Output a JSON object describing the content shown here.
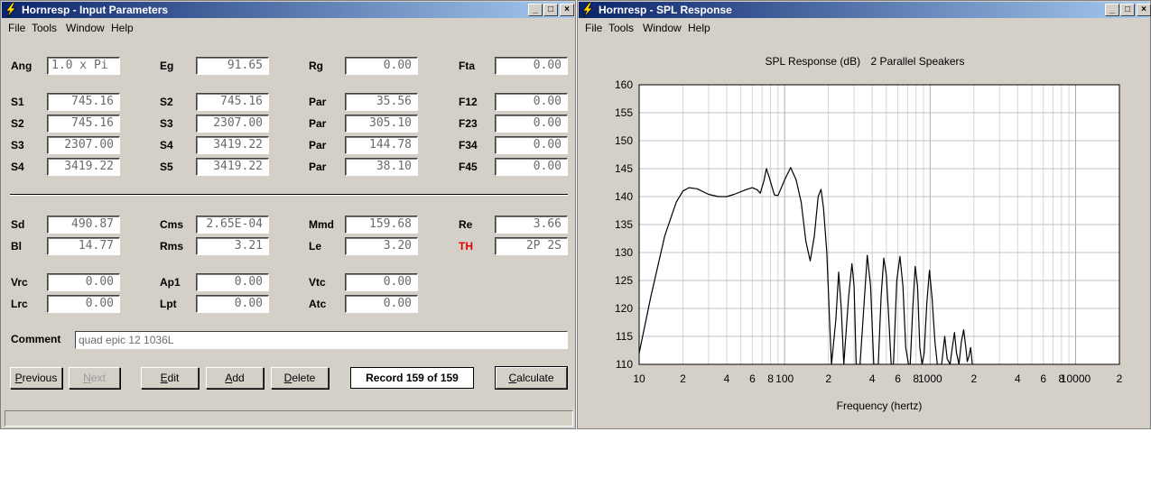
{
  "input_window": {
    "title": "Hornresp - Input Parameters",
    "menu": [
      "File",
      "Tools",
      "Window",
      "Help"
    ],
    "rows": [
      [
        {
          "label": "Ang",
          "value": "1.0 x Pi"
        },
        {
          "label": "Eg",
          "value": "91.65"
        },
        {
          "label": "Rg",
          "value": "0.00"
        },
        {
          "label": "Fta",
          "value": "0.00"
        }
      ],
      [
        {
          "label": "S1",
          "value": "745.16"
        },
        {
          "label": "S2",
          "value": "745.16"
        },
        {
          "label": "Par",
          "value": "35.56"
        },
        {
          "label": "F12",
          "value": "0.00"
        }
      ],
      [
        {
          "label": "S2",
          "value": "745.16"
        },
        {
          "label": "S3",
          "value": "2307.00"
        },
        {
          "label": "Par",
          "value": "305.10"
        },
        {
          "label": "F23",
          "value": "0.00"
        }
      ],
      [
        {
          "label": "S3",
          "value": "2307.00"
        },
        {
          "label": "S4",
          "value": "3419.22"
        },
        {
          "label": "Par",
          "value": "144.78"
        },
        {
          "label": "F34",
          "value": "0.00"
        }
      ],
      [
        {
          "label": "S4",
          "value": "3419.22"
        },
        {
          "label": "S5",
          "value": "3419.22"
        },
        {
          "label": "Par",
          "value": "38.10"
        },
        {
          "label": "F45",
          "value": "0.00"
        }
      ],
      [
        {
          "label": "Sd",
          "value": "490.87"
        },
        {
          "label": "Cms",
          "value": "2.65E-04"
        },
        {
          "label": "Mmd",
          "value": "159.68"
        },
        {
          "label": "Re",
          "value": "3.66"
        }
      ],
      [
        {
          "label": "Bl",
          "value": "14.77"
        },
        {
          "label": "Rms",
          "value": "3.21"
        },
        {
          "label": "Le",
          "value": "3.20"
        },
        {
          "label": "TH",
          "value": "2P 2S"
        }
      ],
      [
        {
          "label": "Vrc",
          "value": "0.00"
        },
        {
          "label": "Ap1",
          "value": "0.00"
        },
        {
          "label": "Vtc",
          "value": "0.00"
        }
      ],
      [
        {
          "label": "Lrc",
          "value": "0.00"
        },
        {
          "label": "Lpt",
          "value": "0.00"
        },
        {
          "label": "Atc",
          "value": "0.00"
        }
      ]
    ],
    "comment_label": "Comment",
    "comment_value": "quad epic 12 1036L",
    "buttons": {
      "previous": "Previous",
      "next": "Next",
      "edit": "Edit",
      "add": "Add",
      "delete": "Delete",
      "calculate": "Calculate"
    },
    "record": "Record 159 of 159"
  },
  "spl_window": {
    "title": "Hornresp - SPL Response",
    "menu": [
      "File",
      "Tools",
      "Window",
      "Help"
    ]
  },
  "colors": {
    "title_start": "#0a246a",
    "title_end": "#a6caf0",
    "window_bg": "#d4d0c8",
    "th_label": "#e00000"
  },
  "chart_data": {
    "type": "line",
    "title": "SPL Response (dB)",
    "subtitle": "2 Parallel Speakers",
    "xlabel": "Frequency (hertz)",
    "ylabel": "",
    "xscale": "log",
    "xlim": [
      10,
      20000
    ],
    "ylim": [
      110,
      160
    ],
    "yticks": [
      110,
      115,
      120,
      125,
      130,
      135,
      140,
      145,
      150,
      155,
      160
    ],
    "xtick_labels": [
      {
        "x": 10,
        "label": "10"
      },
      {
        "x": 20,
        "label": "2"
      },
      {
        "x": 40,
        "label": "4"
      },
      {
        "x": 60,
        "label": "6"
      },
      {
        "x": 80,
        "label": "8"
      },
      {
        "x": 100,
        "label": "100"
      },
      {
        "x": 200,
        "label": "2"
      },
      {
        "x": 400,
        "label": "4"
      },
      {
        "x": 600,
        "label": "6"
      },
      {
        "x": 800,
        "label": "8"
      },
      {
        "x": 1000,
        "label": "1000"
      },
      {
        "x": 2000,
        "label": "2"
      },
      {
        "x": 4000,
        "label": "4"
      },
      {
        "x": 6000,
        "label": "6"
      },
      {
        "x": 8000,
        "label": "8"
      },
      {
        "x": 10000,
        "label": "10000"
      },
      {
        "x": 20000,
        "label": "2"
      }
    ],
    "grid": true,
    "series": [
      {
        "points": [
          [
            10,
            112
          ],
          [
            12,
            122
          ],
          [
            15,
            133
          ],
          [
            18,
            139
          ],
          [
            20,
            141
          ],
          [
            22,
            141.6
          ],
          [
            25,
            141.4
          ],
          [
            30,
            140.4
          ],
          [
            35,
            140
          ],
          [
            40,
            140
          ],
          [
            45,
            140.4
          ],
          [
            55,
            141.3
          ],
          [
            60,
            141.6
          ],
          [
            65,
            141.2
          ],
          [
            68,
            140.6
          ],
          [
            72,
            142.8
          ],
          [
            75,
            145
          ],
          [
            78,
            143.6
          ],
          [
            85,
            140.3
          ],
          [
            90,
            140.2
          ],
          [
            100,
            143
          ],
          [
            110,
            145.2
          ],
          [
            120,
            143
          ],
          [
            130,
            139
          ],
          [
            140,
            132
          ],
          [
            150,
            128.5
          ],
          [
            160,
            133
          ],
          [
            170,
            140
          ],
          [
            178,
            141.3
          ],
          [
            185,
            138
          ],
          [
            195,
            130
          ],
          [
            205,
            116
          ],
          [
            210,
            110
          ],
          [
            225,
            118
          ],
          [
            235,
            126.5
          ],
          [
            245,
            120
          ],
          [
            255,
            110
          ],
          [
            275,
            122
          ],
          [
            290,
            128
          ],
          [
            300,
            124
          ],
          [
            310,
            110
          ],
          [
            330,
            110
          ],
          [
            350,
            120
          ],
          [
            370,
            129.5
          ],
          [
            390,
            124
          ],
          [
            410,
            110
          ],
          [
            440,
            110
          ],
          [
            460,
            122
          ],
          [
            480,
            129
          ],
          [
            500,
            126
          ],
          [
            520,
            118
          ],
          [
            540,
            110
          ],
          [
            560,
            110
          ],
          [
            590,
            125
          ],
          [
            620,
            129.3
          ],
          [
            650,
            124
          ],
          [
            680,
            113
          ],
          [
            710,
            110
          ],
          [
            730,
            110
          ],
          [
            760,
            120
          ],
          [
            790,
            127.5
          ],
          [
            820,
            124
          ],
          [
            850,
            113
          ],
          [
            880,
            110
          ],
          [
            910,
            112
          ],
          [
            950,
            121
          ],
          [
            990,
            126.8
          ],
          [
            1030,
            122
          ],
          [
            1080,
            114
          ],
          [
            1120,
            110
          ],
          [
            1200,
            110
          ],
          [
            1260,
            115
          ],
          [
            1310,
            111
          ],
          [
            1370,
            110
          ],
          [
            1420,
            113
          ],
          [
            1470,
            115.7
          ],
          [
            1520,
            112
          ],
          [
            1580,
            110
          ],
          [
            1640,
            114
          ],
          [
            1700,
            116.2
          ],
          [
            1760,
            113
          ],
          [
            1800,
            110.5
          ],
          [
            1850,
            111.5
          ],
          [
            1900,
            113
          ],
          [
            1950,
            110
          ]
        ]
      }
    ]
  }
}
